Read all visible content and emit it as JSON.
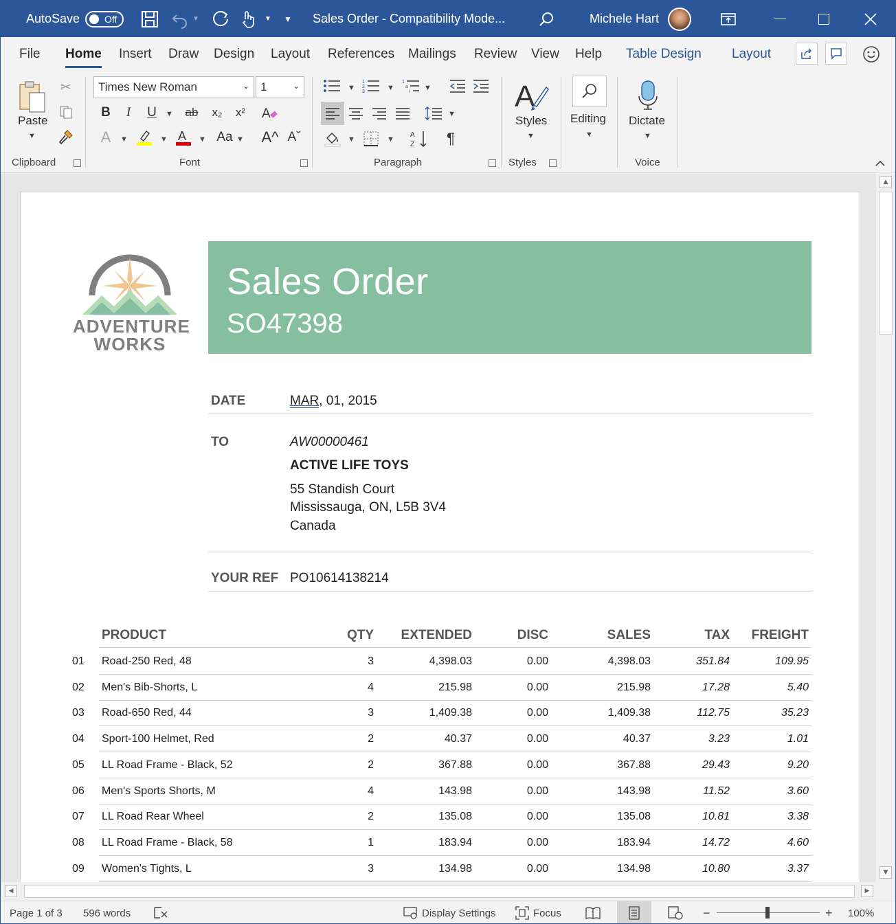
{
  "title_bar": {
    "autosave_label": "AutoSave",
    "autosave_state": "Off",
    "doc_title": "Sales Order  -  Compatibility Mode...",
    "user_name": "Michele Hart"
  },
  "menu": {
    "tabs": [
      "File",
      "Home",
      "Insert",
      "Draw",
      "Design",
      "Layout",
      "References",
      "Mailings",
      "Review",
      "View",
      "Help",
      "Table Design",
      "Layout"
    ]
  },
  "ribbon": {
    "font_name": "Times New Roman",
    "font_size": "1",
    "paste_label": "Paste",
    "styles_label": "Styles",
    "editing_label": "Editing",
    "dictate_label": "Dictate",
    "groups": {
      "clipboard": "Clipboard",
      "font": "Font",
      "paragraph": "Paragraph",
      "styles": "Styles",
      "voice": "Voice"
    },
    "glyphs": {
      "bold": "B",
      "italic": "I",
      "underline": "U",
      "strike": "ab",
      "subscript": "x₂",
      "superscript": "x²",
      "case": "Aa",
      "grow": "A^",
      "shrink": "Aˇ",
      "pilcrow": "¶"
    }
  },
  "document": {
    "logo_line1": "ADVENTURE",
    "logo_line2": "WORKS",
    "banner_title": "Sales Order",
    "banner_number": "SO47398",
    "date_label": "DATE",
    "date_month": "MAR,",
    "date_rest": " 01, 2015",
    "to_label": "TO",
    "customer_id": "AW00000461",
    "customer_name": "ACTIVE LIFE TOYS",
    "address_line1": "55 Standish Court",
    "address_line2": "Mississauga, ON, L5B 3V4",
    "address_line3": "Canada",
    "ref_label": "YOUR REF",
    "ref_value": "PO10614138214",
    "columns": [
      "PRODUCT",
      "QTY",
      "EXTENDED",
      "DISC",
      "SALES",
      "TAX",
      "FREIGHT"
    ],
    "rows": [
      [
        "01",
        "Road-250 Red, 48",
        "3",
        "4,398.03",
        "0.00",
        "4,398.03",
        "351.84",
        "109.95"
      ],
      [
        "02",
        "Men's Bib-Shorts, L",
        "4",
        "215.98",
        "0.00",
        "215.98",
        "17.28",
        "5.40"
      ],
      [
        "03",
        "Road-650 Red, 44",
        "3",
        "1,409.38",
        "0.00",
        "1,409.38",
        "112.75",
        "35.23"
      ],
      [
        "04",
        "Sport-100 Helmet, Red",
        "2",
        "40.37",
        "0.00",
        "40.37",
        "3.23",
        "1.01"
      ],
      [
        "05",
        "LL Road Frame - Black, 52",
        "2",
        "367.88",
        "0.00",
        "367.88",
        "29.43",
        "9.20"
      ],
      [
        "06",
        "Men's Sports Shorts, M",
        "4",
        "143.98",
        "0.00",
        "143.98",
        "11.52",
        "3.60"
      ],
      [
        "07",
        "LL Road Rear Wheel",
        "2",
        "135.08",
        "0.00",
        "135.08",
        "10.81",
        "3.38"
      ],
      [
        "08",
        "LL Road Frame - Black, 58",
        "1",
        "183.94",
        "0.00",
        "183.94",
        "14.72",
        "4.60"
      ],
      [
        "09",
        "Women's Tights, L",
        "3",
        "134.98",
        "0.00",
        "134.98",
        "10.80",
        "3.37"
      ]
    ]
  },
  "status_bar": {
    "page": "Page 1 of 3",
    "words": "596 words",
    "display_settings": "Display Settings",
    "focus": "Focus",
    "zoom": "100%"
  },
  "colors": {
    "title_bar": "#2b579a",
    "banner": "#86bf9f",
    "highlight": "#ffff00",
    "font_color": "#e00000"
  }
}
